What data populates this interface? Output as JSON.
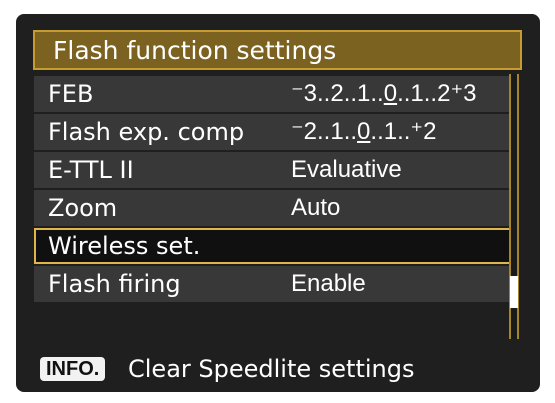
{
  "title": "Flash function settings",
  "menu": {
    "items": [
      {
        "label": "FEB",
        "value": "⁻3..2..1..̲\u00180..1..2⁺3"
      },
      {
        "label": "Flash exp. comp",
        "value": "⁻2..1..̲\u00180..1..⁺2"
      },
      {
        "label": "E-TTL II",
        "value": "Evaluative"
      },
      {
        "label": "Zoom",
        "value": "Auto"
      },
      {
        "label": "Wireless set.",
        "value": ""
      },
      {
        "label": "Flash firing",
        "value": "Enable"
      }
    ],
    "selected_index": 4
  },
  "footer": {
    "key_label": "INFO.",
    "action_text": "Clear Speedlite settings"
  },
  "colors": {
    "background": "#1f1f1f",
    "title_bar": "#7b6221",
    "accent": "#e0b54a",
    "row": "#383838"
  }
}
